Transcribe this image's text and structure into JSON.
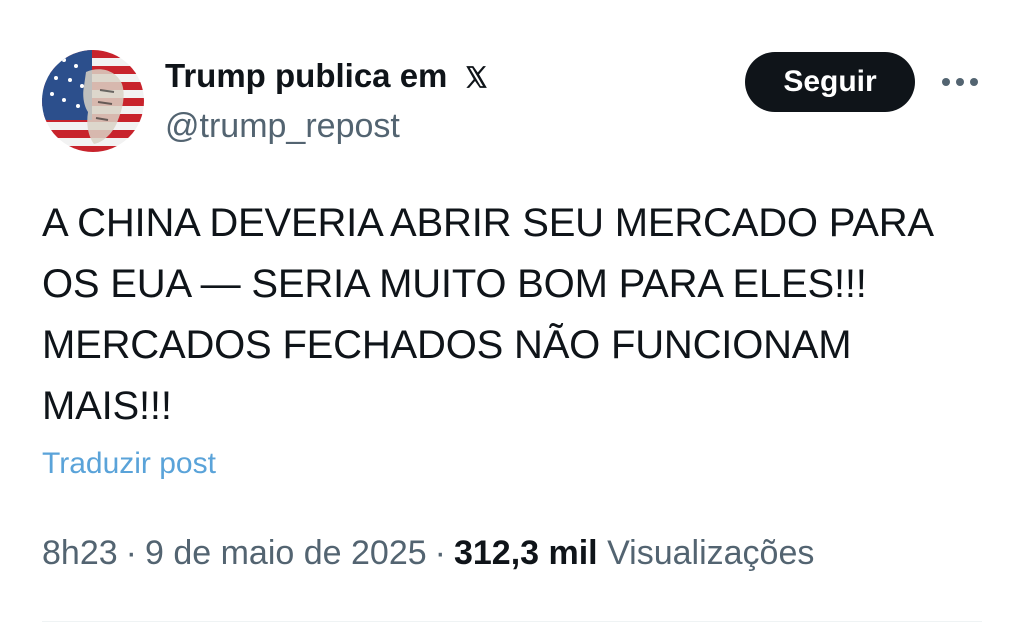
{
  "author": {
    "display_name": "Trump publica em",
    "handle": "@trump_repost",
    "avatar_icon": "american-flag-portrait-avatar",
    "badge_icon": "x-logo-icon"
  },
  "actions": {
    "follow_label": "Seguir",
    "more_icon": "more-horizontal-icon"
  },
  "post": {
    "text": "A CHINA DEVERIA ABRIR SEU MERCADO PARA\nOS EUA — SERIA MUITO BOM PARA ELES!!!\nMERCADOS FECHADOS NÃO FUNCIONAM\nMAIS!!!",
    "translate_label": "Traduzir post"
  },
  "meta": {
    "time": "8h23",
    "separator": "·",
    "date": "9 de maio de 2025",
    "views_count": "312,3 mil",
    "views_label": "Visualizações"
  },
  "colors": {
    "text_primary": "#0f1419",
    "text_secondary": "#536471",
    "link": "#5aa3d9",
    "button_bg": "#0f1419",
    "button_text": "#ffffff"
  }
}
